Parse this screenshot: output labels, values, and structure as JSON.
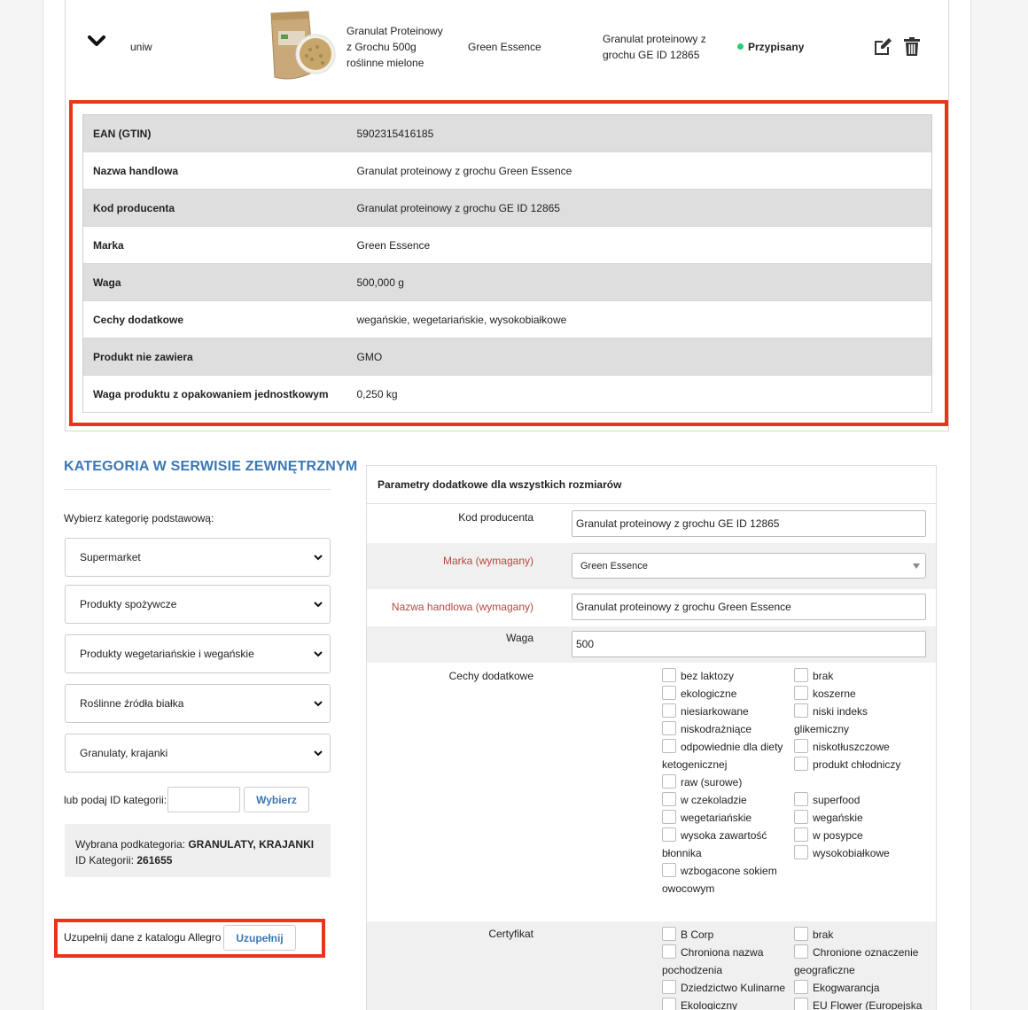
{
  "product": {
    "variant": "uniw",
    "name_lines": [
      "Granulat Proteinowy",
      "z Grochu 500g",
      "roślinne mielone"
    ],
    "brand": "Green Essence",
    "catalog_name_lines": [
      "Granulat proteinowy z",
      "grochu GE ID 12865"
    ],
    "status": "Przypisany",
    "status_color": "#2ecc71"
  },
  "details": [
    {
      "key": "EAN (GTIN)",
      "value": "5902315416185"
    },
    {
      "key": "Nazwa handlowa",
      "value": "Granulat proteinowy z grochu Green Essence"
    },
    {
      "key": "Kod producenta",
      "value": "Granulat proteinowy z grochu GE ID 12865"
    },
    {
      "key": "Marka",
      "value": "Green Essence"
    },
    {
      "key": "Waga",
      "value": "500,000 g"
    },
    {
      "key": "Cechy dodatkowe",
      "value": "wegańskie, wegetariańskie, wysokobiałkowe"
    },
    {
      "key": "Produkt nie zawiera",
      "value": "GMO"
    },
    {
      "key": "Waga produktu z opakowaniem jednostkowym",
      "value": "0,250 kg"
    }
  ],
  "category": {
    "title": "KATEGORIA W SERWISIE ZEWNĘTRZNYM",
    "choose_label": "Wybierz kategorię podstawową:",
    "selects": [
      "Supermarket",
      "Produkty spożywcze",
      "Produkty wegetariańskie i wegańskie",
      "Roślinne źródła białka",
      "Granulaty, krajanki"
    ],
    "id_label": "lub podaj ID kategorii:",
    "id_value": "",
    "choose_button": "Wybierz",
    "selected_label": "Wybrana podkategoria:",
    "selected_value": "GRANULATY, KRAJANKI",
    "id_info_label": "ID Kategorii:",
    "id_info_value": "261655",
    "fill_label": "Uzupełnij dane z katalogu Allegro",
    "fill_button": "Uzupełnij"
  },
  "params": {
    "title": "Parametry dodatkowe dla wszystkich rozmiarów",
    "kod_label": "Kod producenta",
    "kod_value": "Granulat proteinowy z grochu GE ID 12865",
    "marka_label": "Marka (wymagany)",
    "marka_value": "Green Essence",
    "nazwa_label": "Nazwa handlowa (wymagany)",
    "nazwa_value": "Granulat proteinowy z grochu Green Essence",
    "waga_label": "Waga",
    "waga_value": "500",
    "cechy_label": "Cechy dodatkowe",
    "cechy_left": [
      "bez laktozy",
      "ekologiczne",
      "niesiarkowane",
      "niskodrażniące",
      "odpowiednie dla diety",
      "ketogenicznej",
      "raw (surowe)",
      "w czekoladzie",
      "wegetariańskie",
      "wysoka zawartość",
      "błonnika",
      "wzbogacone sokiem",
      "owocowym"
    ],
    "cechy_right": [
      "brak",
      "koszerne",
      "niski indeks",
      "glikemiczny",
      "niskotłuszczowe",
      "produkt chłodniczy",
      "superfood",
      "wegańskie",
      "w posypce",
      "wysokobiałkowe"
    ],
    "cert_label": "Certyfikat",
    "cert_left": [
      "B Corp",
      "Chroniona nazwa",
      "pochodzenia",
      "Dziedzictwo Kulinarne",
      "Ekologiczny"
    ],
    "cert_right": [
      "brak",
      "Chronione oznaczenie",
      "geograficzne",
      "Ekogwarancja",
      "EU Flower (Europejska"
    ]
  }
}
